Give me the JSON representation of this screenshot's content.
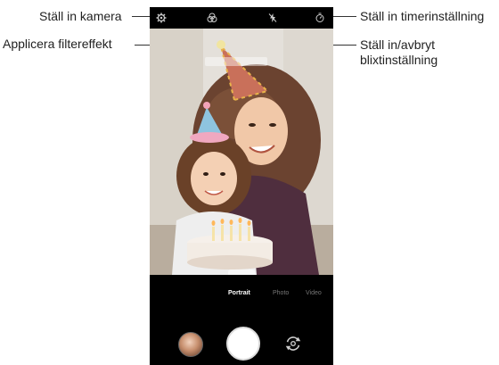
{
  "callouts": {
    "camera_settings": "Ställ in kamera",
    "filter_effect": "Applicera filtereffekt",
    "timer": "Ställ in timerinställning",
    "flash_line1": "Ställ in/avbryt",
    "flash_line2": "blixtinställning"
  },
  "camera": {
    "modes": [
      "Portrait",
      "Photo",
      "Video"
    ],
    "active_mode": "Portrait"
  },
  "icons": {
    "settings": "gear-icon",
    "filter": "filter-icon",
    "flash": "flash-off-icon",
    "timer": "timer-icon",
    "gallery": "gallery-thumbnail",
    "shutter": "shutter-button",
    "switch": "switch-camera-icon"
  }
}
